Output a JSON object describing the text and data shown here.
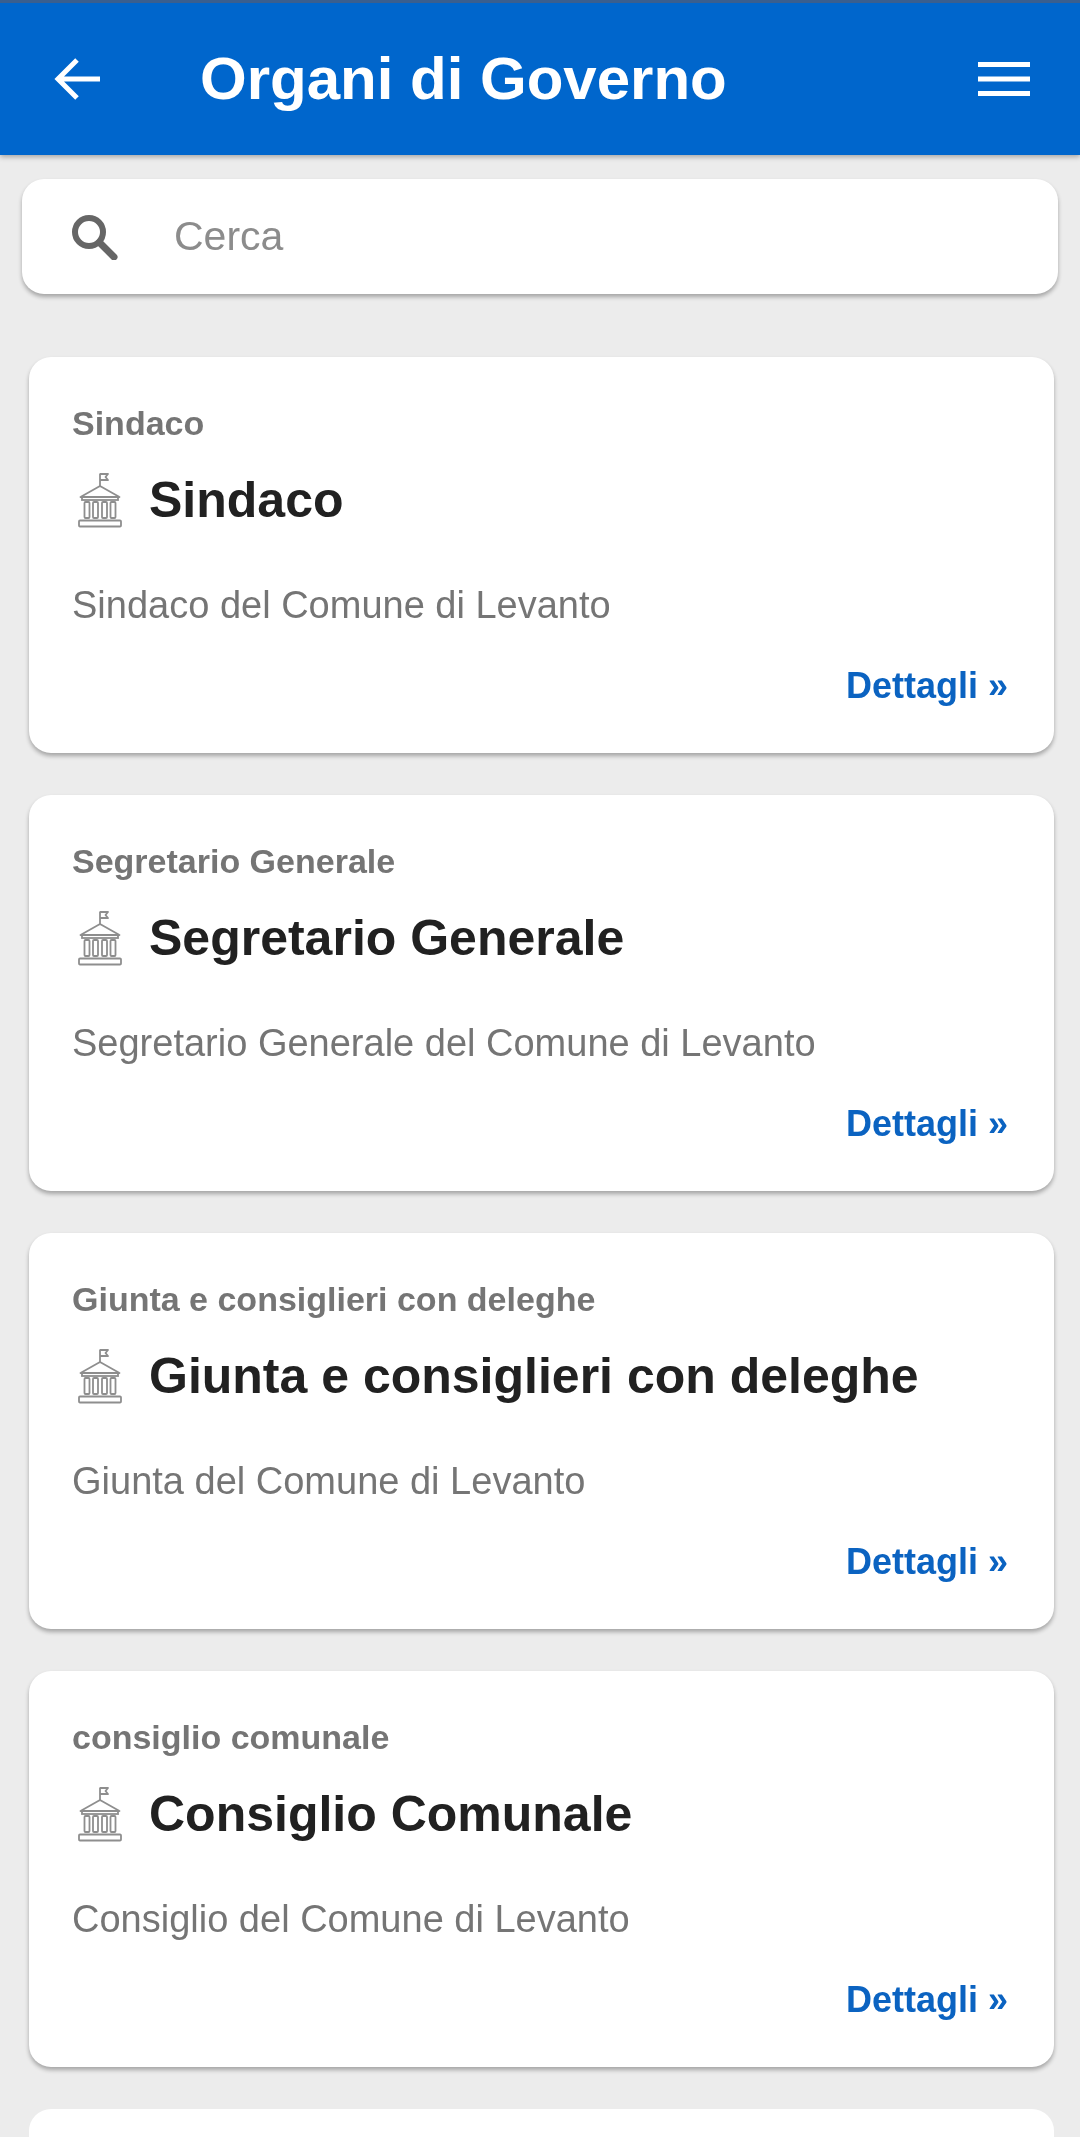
{
  "header": {
    "title": "Organi di Governo"
  },
  "search": {
    "placeholder": "Cerca"
  },
  "cards": [
    {
      "category": "Sindaco",
      "title": "Sindaco",
      "description": "Sindaco del Comune di Levanto",
      "link": "Dettagli »"
    },
    {
      "category": "Segretario Generale",
      "title": "Segretario Generale",
      "description": "Segretario Generale del Comune di Levanto",
      "link": "Dettagli »"
    },
    {
      "category": "Giunta e consiglieri con deleghe",
      "title": "Giunta e consiglieri con deleghe",
      "description": "Giunta del Comune di Levanto",
      "link": "Dettagli »"
    },
    {
      "category": "consiglio comunale",
      "title": "Consiglio Comunale",
      "description": "Consiglio del Comune di Levanto",
      "link": "Dettagli »"
    }
  ]
}
